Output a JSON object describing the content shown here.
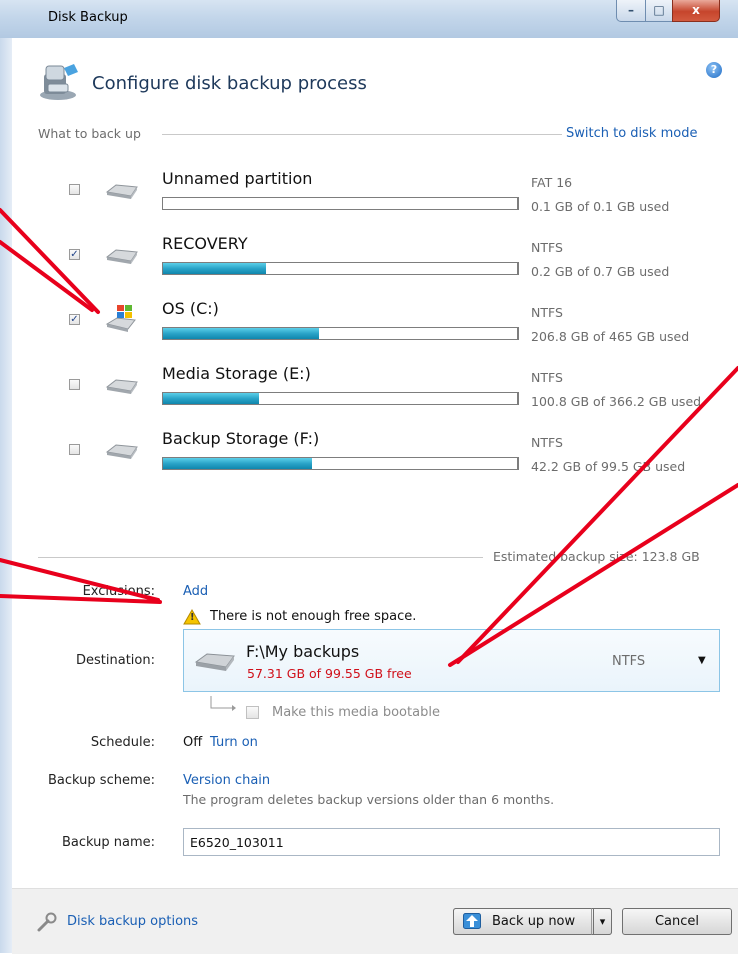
{
  "window": {
    "title": "Disk Backup",
    "close_glyph": "x",
    "max_glyph": "□",
    "min_glyph": "–"
  },
  "header": {
    "title": "Configure disk backup process",
    "help_glyph": "?"
  },
  "what_to_back_up": {
    "label": "What to back up",
    "switch_link": "Switch to disk mode"
  },
  "partitions": [
    {
      "name": "Unnamed partition",
      "fs": "FAT 16",
      "usage": "0.1 GB of 0.1 GB used",
      "checked": false,
      "fill": 0.0
    },
    {
      "name": "RECOVERY",
      "fs": "NTFS",
      "usage": "0.2 GB of 0.7 GB used",
      "checked": true,
      "fill": 0.29
    },
    {
      "name": "OS (C:)",
      "fs": "NTFS",
      "usage": "206.8 GB of 465 GB used",
      "checked": true,
      "fill": 0.44
    },
    {
      "name": "Media Storage (E:)",
      "fs": "NTFS",
      "usage": "100.8 GB of 366.2 GB used",
      "checked": false,
      "fill": 0.27
    },
    {
      "name": "Backup Storage (F:)",
      "fs": "NTFS",
      "usage": "42.2 GB of 99.5 GB used",
      "checked": false,
      "fill": 0.42
    }
  ],
  "estimated": "Estimated backup size: 123.8 GB",
  "exclusions": {
    "label": "Exclusions:",
    "link": "Add"
  },
  "warning": {
    "text": "There is not enough free space.",
    "glyph": "!"
  },
  "destination": {
    "label": "Destination:",
    "name": "F:\\My backups",
    "free": "57.31 GB of 99.55 GB free",
    "fs": "NTFS",
    "arrow": "▼"
  },
  "bootable": {
    "label": "Make this media bootable"
  },
  "schedule": {
    "label": "Schedule:",
    "value": "Off",
    "link": "Turn on"
  },
  "scheme": {
    "label": "Backup scheme:",
    "link": "Version chain",
    "description": "The program deletes backup versions older than 6 months."
  },
  "backup_name": {
    "label": "Backup name:",
    "value": "E6520_103011"
  },
  "footer": {
    "options_link": "Disk backup options",
    "backup_button": "Back up now",
    "backup_arrow": "▾",
    "cancel_button": "Cancel"
  },
  "colors": {
    "annotation": "#e8001c",
    "link": "#1a5fb4",
    "error": "#d0101a",
    "bar_fill": "#2aa4c8"
  }
}
